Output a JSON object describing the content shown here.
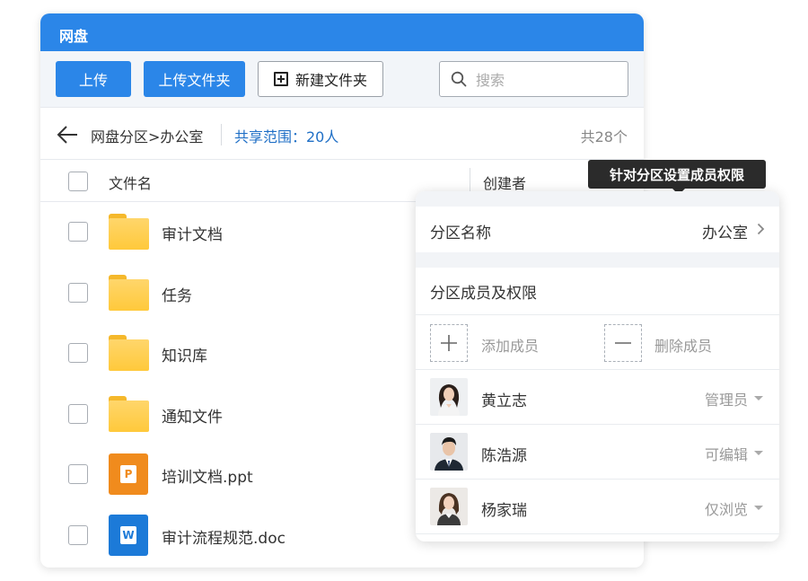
{
  "app": {
    "title": "网盘"
  },
  "toolbar": {
    "upload_label": "上传",
    "upload_folder_label": "上传文件夹",
    "new_folder_label": "新建文件夹",
    "search_placeholder": "搜索"
  },
  "pathbar": {
    "breadcrumb": "网盘分区>办公室",
    "share_range": "共享范围：20人",
    "count": "共28个"
  },
  "table": {
    "headers": {
      "name": "文件名",
      "creator": "创建者"
    },
    "rows": [
      {
        "name": "审计文档",
        "type": "folder"
      },
      {
        "name": "任务",
        "type": "folder"
      },
      {
        "name": "知识库",
        "type": "folder"
      },
      {
        "name": "通知文件",
        "type": "folder"
      },
      {
        "name": "培训文档.ppt",
        "type": "ppt",
        "icon_letter": "P"
      },
      {
        "name": "审计流程规范.doc",
        "type": "doc",
        "icon_letter": "W"
      }
    ]
  },
  "tooltip": {
    "text": "针对分区设置成员权限"
  },
  "panel": {
    "zone_name_label": "分区名称",
    "zone_name_value": "办公室",
    "members_title": "分区成员及权限",
    "add_member_label": "添加成员",
    "remove_member_label": "删除成员",
    "members": [
      {
        "name": "黄立志",
        "role": "管理员"
      },
      {
        "name": "陈浩源",
        "role": "可编辑"
      },
      {
        "name": "杨家瑞",
        "role": "仅浏览"
      }
    ]
  },
  "colors": {
    "primary": "#2b86e8",
    "link": "#1f6fc6",
    "folder": "#ffc93b",
    "ppt": "#f08b1d",
    "word": "#1c7ad8"
  }
}
